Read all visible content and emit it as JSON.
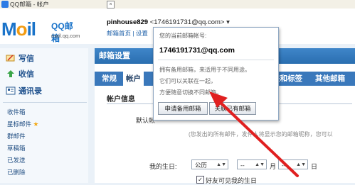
{
  "browser": {
    "tab_title": "QQ邮箱 - 帐户",
    "close_glyph": "×"
  },
  "header": {
    "logo_text": "M",
    "logo_text2": "il",
    "logo_brand": "QQ邮箱",
    "logo_domain": "mail.qq.com",
    "username": "pinhouse829",
    "address": "<1746191731@qq.com>",
    "caret": "▾",
    "links": "邮箱首页 | 设置"
  },
  "sidebar": {
    "write": "写信",
    "receive": "收信",
    "contacts": "通讯录",
    "folders": [
      "收件箱",
      "星标邮件",
      "群邮件",
      "草稿箱",
      "已发送",
      "已删除"
    ],
    "star_glyph": "★"
  },
  "main": {
    "panel_title": "邮箱设置",
    "tabs": [
      "常规",
      "帐户",
      "夹和标签",
      "其他邮箱"
    ],
    "section_title": "帐户信息",
    "default_label": "默认帐",
    "default_hint": "(您发出的所有邮件，发件人将显示您的邮箱昵称，您可以",
    "birthday_label": "我的生日:",
    "calendar_value": "公历",
    "dash1": "--",
    "month_label": "月",
    "dash2": "--",
    "day_label": "日",
    "friends_checkbox": "好友可见我的生日"
  },
  "popup": {
    "intro": "您的当前邮箱帐号:",
    "email": "1746191731@qq.com",
    "line1": "拥有备用邮箱，来适用于不同用途。",
    "line2": "它们可以关联在一起，",
    "line3": "方便随意切换不同邮箱。",
    "btn_apply": "申请备用邮箱",
    "btn_link": "关联已有邮箱"
  }
}
